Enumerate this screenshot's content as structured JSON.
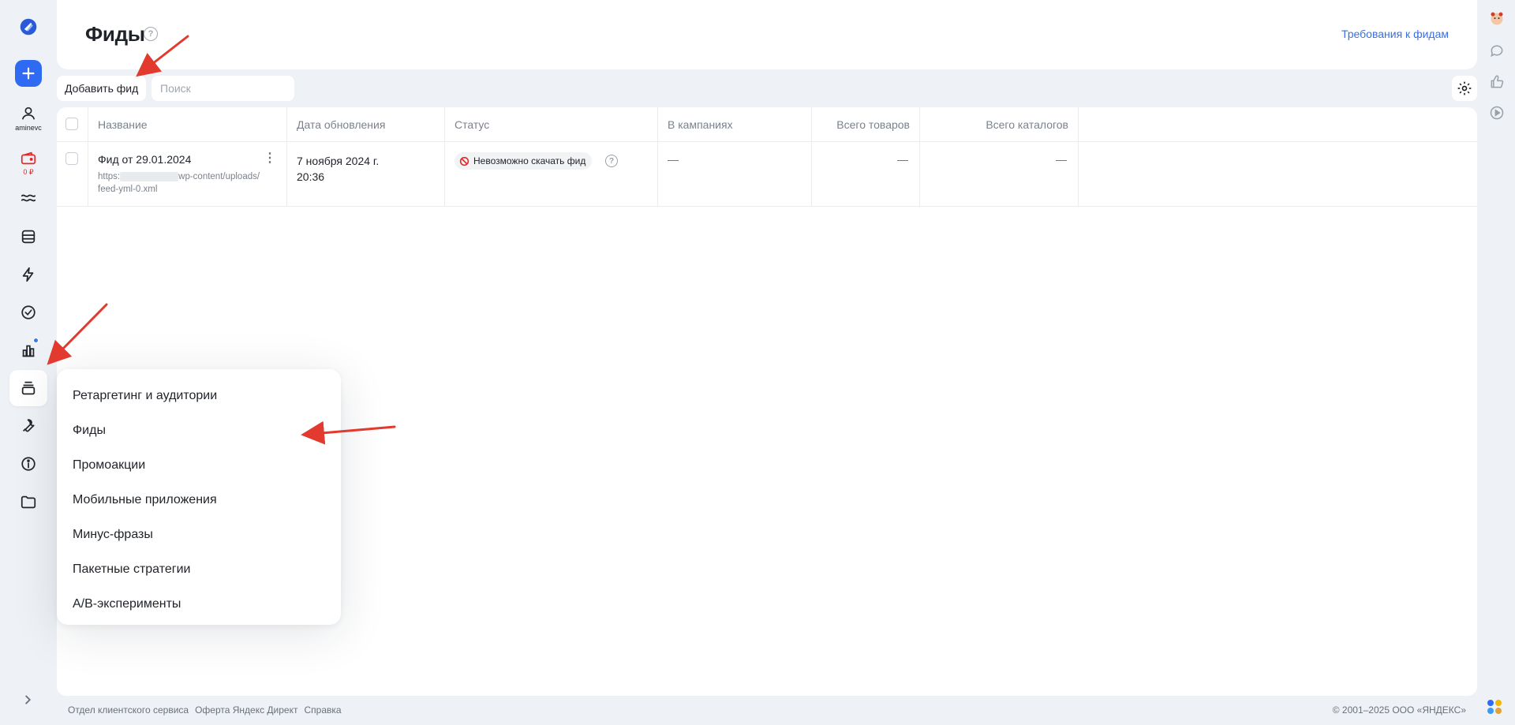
{
  "left_rail": {
    "user_label": "aminevc",
    "balance": "0 ₽",
    "items": [
      "logo-icon",
      "plus-icon",
      "user-icon",
      "wallet-icon",
      "waves-icon",
      "database-icon",
      "bolt-icon",
      "check-circle-icon",
      "bar-chart-icon",
      "library-icon",
      "wrench-icon",
      "info-icon",
      "folder-icon",
      "chevron-right-icon"
    ]
  },
  "header": {
    "title": "Фиды",
    "help_icon": "?",
    "requirements_link": "Требования к фидам"
  },
  "toolbar": {
    "add_feed_label": "Добавить фид",
    "search_placeholder": "Поиск"
  },
  "table": {
    "columns": [
      "Название",
      "Дата обновления",
      "Статус",
      "В кампаниях",
      "Всего товаров",
      "Всего каталогов"
    ],
    "rows": [
      {
        "name": "Фид от 29.01.2024",
        "url_start": "https:",
        "url_end": "wp-content/uploads/",
        "url_file": "feed-yml-0.xml",
        "date_line1": "7 ноября 2024 г.",
        "date_line2": "20:36",
        "status": "Невозможно скачать фид",
        "campaigns": "—",
        "goods": "—",
        "catalogs": "—"
      }
    ]
  },
  "menu": {
    "items": [
      "Ретаргетинг и аудитории",
      "Фиды",
      "Промоакции",
      "Мобильные приложения",
      "Минус-фразы",
      "Пакетные стратегии",
      "A/B-эксперименты"
    ]
  },
  "footer": {
    "links": [
      "Отдел клиентского сервиса",
      "Оферта Яндекс Директ",
      "Справка"
    ],
    "copyright": "© 2001–2025 ООО «ЯНДЕКС»"
  },
  "colors": {
    "accent": "#2e6bf2",
    "link": "#3a6fe0",
    "error": "#e12b2b",
    "arrow": "#e23a2e",
    "background": "#eef1f5"
  }
}
